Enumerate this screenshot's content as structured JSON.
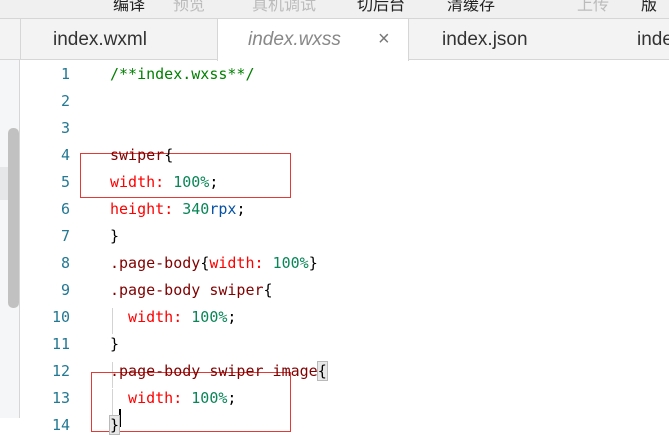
{
  "toolbar": {
    "items": [
      {
        "label": "编译",
        "disabled": false
      },
      {
        "label": "预览",
        "disabled": true
      },
      {
        "label": "真机调试",
        "disabled": true
      },
      {
        "label": "切后台",
        "disabled": false
      },
      {
        "label": "清缓存",
        "disabled": false
      },
      {
        "label": "上传",
        "disabled": true
      },
      {
        "label": "版本",
        "disabled": false
      }
    ]
  },
  "tabs": [
    {
      "label": "index.wxml",
      "active": false
    },
    {
      "label": "index.wxss",
      "active": true,
      "close_icon": "×"
    },
    {
      "label": "index.json",
      "active": false
    },
    {
      "label": "index.js",
      "active": false
    }
  ],
  "editor": {
    "lines": [
      {
        "n": "1",
        "tokens": [
          {
            "t": "/**index.wxss**/",
            "c": "comment"
          }
        ]
      },
      {
        "n": "2",
        "tokens": []
      },
      {
        "n": "3",
        "tokens": []
      },
      {
        "n": "4",
        "tokens": [
          {
            "t": "swiper",
            "c": "sel"
          },
          {
            "t": "{",
            "c": "punc"
          }
        ]
      },
      {
        "n": "5",
        "tokens": [
          {
            "t": "width",
            "c": "prop"
          },
          {
            "t": ": ",
            "c": "prop"
          },
          {
            "t": "100%",
            "c": "num"
          },
          {
            "t": ";",
            "c": "punc"
          }
        ]
      },
      {
        "n": "6",
        "tokens": [
          {
            "t": "height",
            "c": "prop"
          },
          {
            "t": ": ",
            "c": "prop"
          },
          {
            "t": "340",
            "c": "num"
          },
          {
            "t": "rpx",
            "c": "unit"
          },
          {
            "t": ";",
            "c": "punc"
          }
        ]
      },
      {
        "n": "7",
        "tokens": [
          {
            "t": "}",
            "c": "punc"
          }
        ]
      },
      {
        "n": "8",
        "tokens": [
          {
            "t": ".page-body",
            "c": "sel"
          },
          {
            "t": "{",
            "c": "punc"
          },
          {
            "t": "width",
            "c": "prop"
          },
          {
            "t": ": ",
            "c": "prop"
          },
          {
            "t": "100%",
            "c": "num"
          },
          {
            "t": "}",
            "c": "punc"
          }
        ]
      },
      {
        "n": "9",
        "tokens": [
          {
            "t": ".page-body swiper",
            "c": "sel"
          },
          {
            "t": "{",
            "c": "punc"
          }
        ]
      },
      {
        "n": "10",
        "tokens": [
          {
            "t": "  width",
            "c": "prop"
          },
          {
            "t": ": ",
            "c": "prop"
          },
          {
            "t": "100%",
            "c": "num"
          },
          {
            "t": ";",
            "c": "punc"
          }
        ]
      },
      {
        "n": "11",
        "tokens": [
          {
            "t": "}",
            "c": "punc"
          }
        ]
      },
      {
        "n": "12",
        "tokens": [
          {
            "t": ".page-body swiper image",
            "c": "sel"
          },
          {
            "t": "{",
            "c": "punc bracket"
          }
        ]
      },
      {
        "n": "13",
        "tokens": [
          {
            "t": "  width",
            "c": "prop"
          },
          {
            "t": ": ",
            "c": "prop"
          },
          {
            "t": "100%",
            "c": "num"
          },
          {
            "t": ";",
            "c": "punc"
          }
        ]
      },
      {
        "n": "14",
        "tokens": [
          {
            "t": "}",
            "c": "punc bracket"
          }
        ]
      }
    ]
  }
}
